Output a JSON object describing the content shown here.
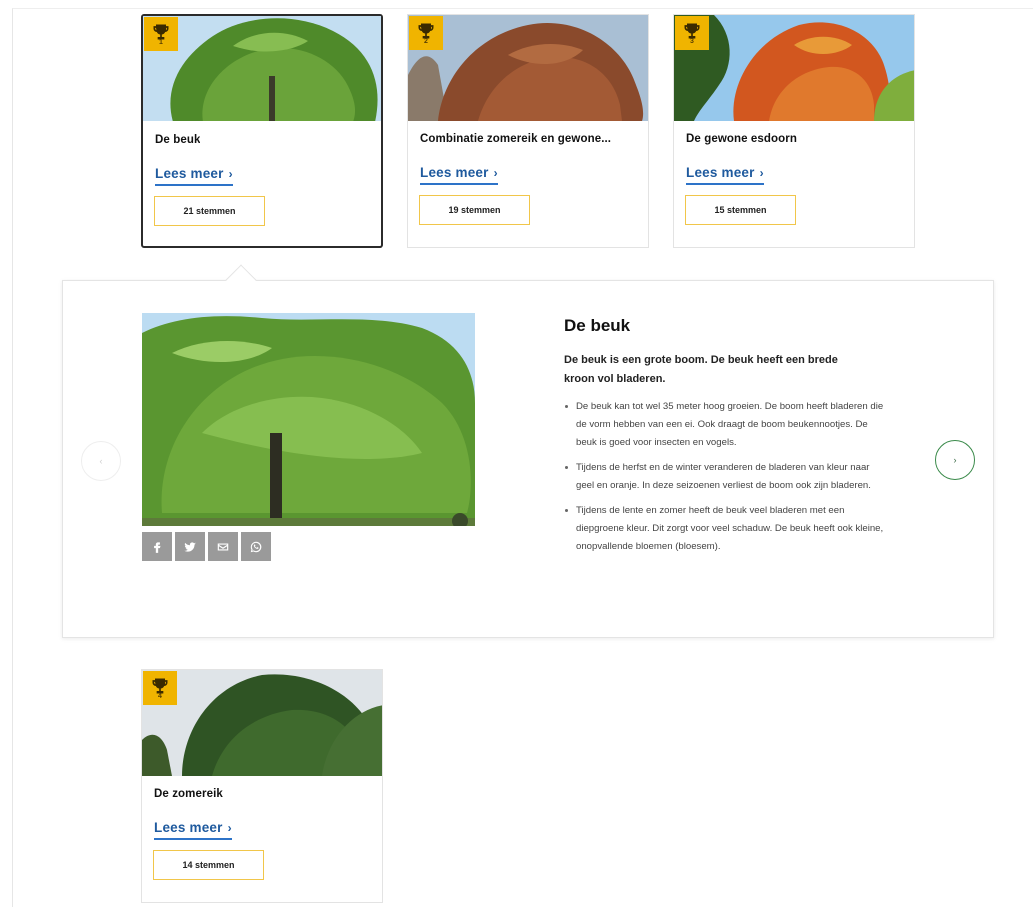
{
  "cards": [
    {
      "rank": "1",
      "title": "De beuk",
      "link_label": "Lees meer",
      "link_chevron": "›",
      "votes": "21 stemmen",
      "selected": true
    },
    {
      "rank": "2",
      "title": "Combinatie zomereik en gewone...",
      "link_label": "Lees meer",
      "link_chevron": "›",
      "votes": "19 stemmen",
      "selected": false
    },
    {
      "rank": "3",
      "title": "De gewone esdoorn",
      "link_label": "Lees meer",
      "link_chevron": "›",
      "votes": "15 stemmen",
      "selected": false
    },
    {
      "rank": "4",
      "title": "De zomereik",
      "link_label": "Lees meer",
      "link_chevron": "›",
      "votes": "14 stemmen",
      "selected": false
    }
  ],
  "detail": {
    "title": "De beuk",
    "intro": "De beuk is een grote boom. De beuk heeft een brede kroon vol bladeren.",
    "bullets": [
      "De beuk kan tot wel 35 meter hoog groeien. De boom heeft bladeren die de vorm hebben van een ei. Ook draagt de boom beukennootjes. De beuk is goed voor insecten en vogels.",
      "Tijdens de herfst en de winter veranderen de bladeren van kleur naar geel en oranje. In deze seizoenen verliest de boom ook zijn bladeren.",
      "Tijdens de lente en zomer heeft de beuk veel bladeren met een diepgroene kleur. Dit zorgt voor veel schaduw. De beuk heeft ook kleine, onopvallende bloemen (bloesem)."
    ],
    "share_icons": [
      "facebook-icon",
      "twitter-icon",
      "email-icon",
      "whatsapp-icon"
    ]
  },
  "nav": {
    "prev_symbol": "‹",
    "next_symbol": "›"
  },
  "colors": {
    "trophy": "#f0b400",
    "link": "#1f5a9e",
    "link_underline": "#2d73c8",
    "votes_border": "#f1c64a",
    "next_button_border": "#3a8a4a",
    "share_button": "#9a9a9a"
  }
}
